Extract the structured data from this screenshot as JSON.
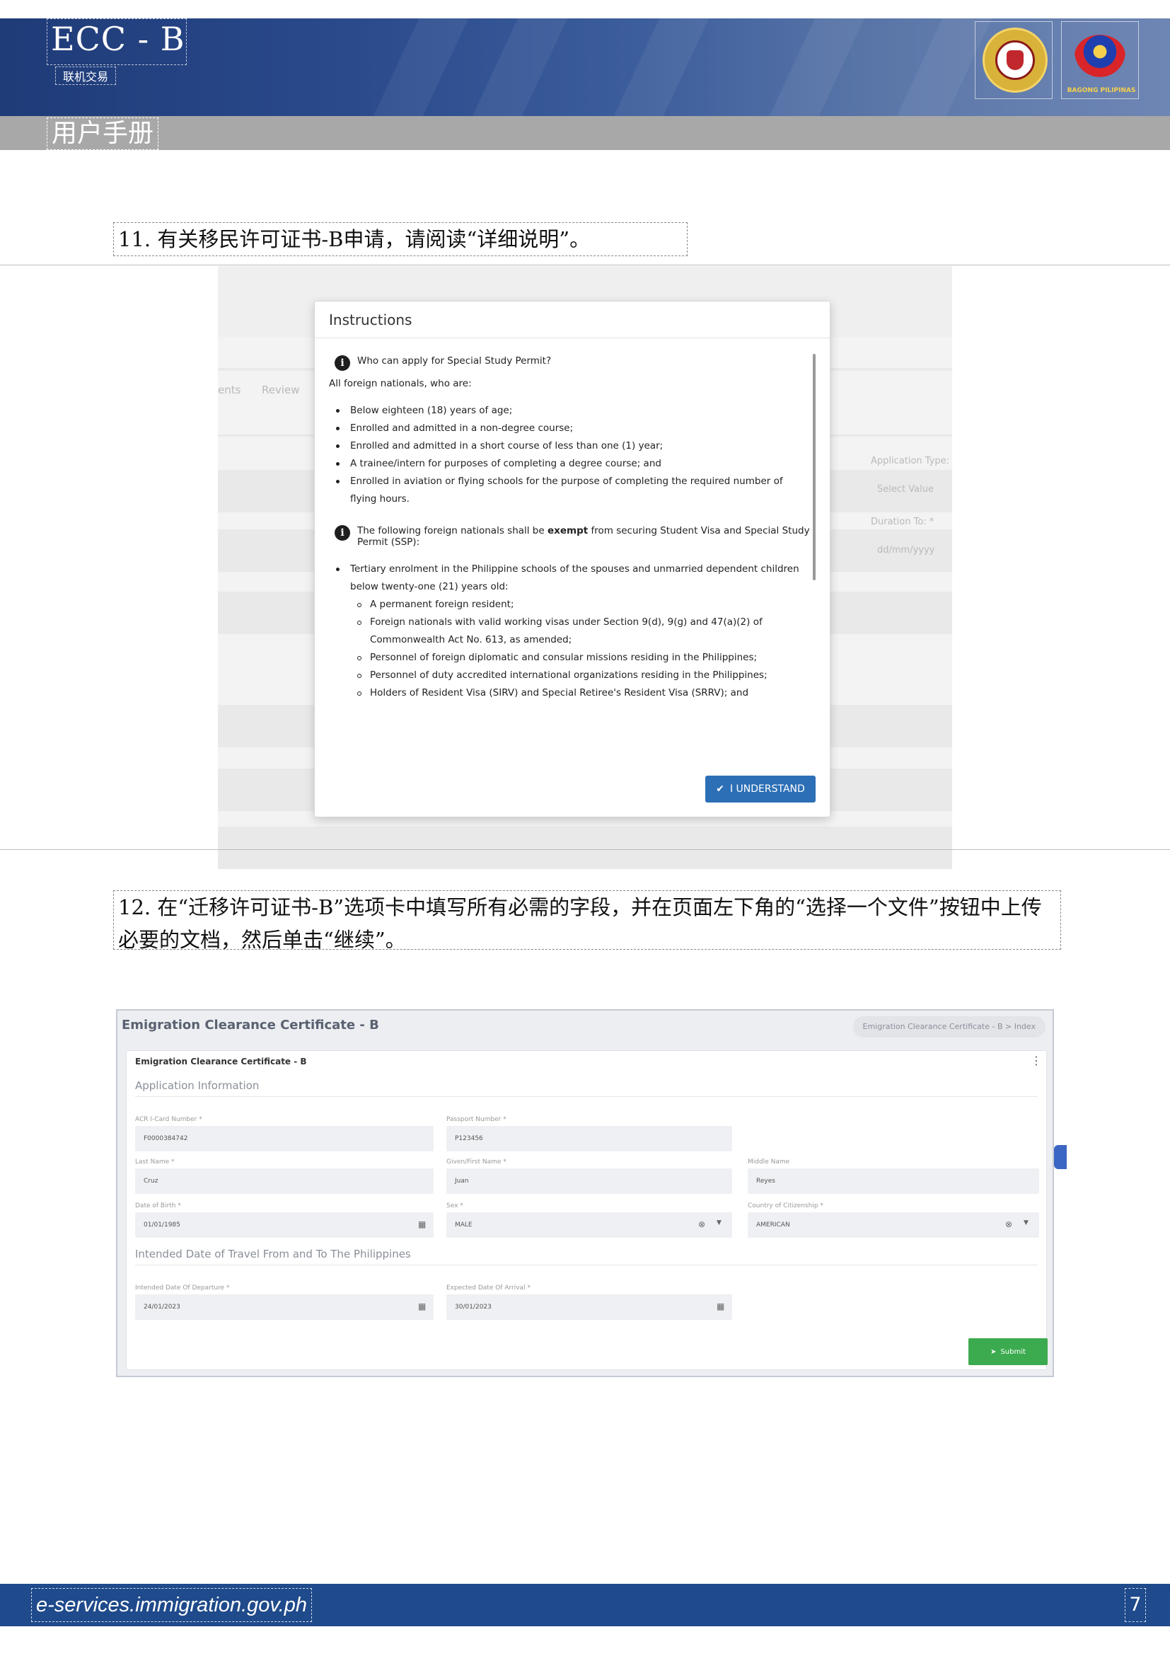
{
  "header": {
    "brand_title": "ECC - B",
    "brand_subtitle": "联机交易",
    "manual_title": "用户手册",
    "logo_seal_text": "BUREAU OF IMMIGRATION",
    "logo_bp_text": "BAGONG PILIPINAS"
  },
  "steps": {
    "step11": "11. 有关移民许可证书-B申请，请阅读“详细说明”。",
    "step12": "12. 在“迁移许可证书-B”选项卡中填写所有必需的字段，并在页面左下角的“选择一个文件”按钮中上传必要的文档，然后单击“继续”。"
  },
  "instructions_modal": {
    "title": "Instructions",
    "q1": "Who can apply for Special Study Permit?",
    "intro": "All foreign nationals, who are:",
    "items": [
      "Below eighteen (18) years of age;",
      "Enrolled and admitted in a non-degree course;",
      "Enrolled and admitted in a short course of less than one (1) year;",
      "A trainee/intern for purposes of completing a degree course; and",
      "Enrolled in aviation or flying schools for the purpose of completing the required number of flying hours."
    ],
    "exempt_note_pre": "The following foreign nationals shall be ",
    "exempt_note_bold": "exempt",
    "exempt_note_post": " from securing Student Visa and Special Study Permit (SSP):",
    "exempt_item": "Tertiary enrolment in the Philippine schools of the spouses and unmarried dependent children below twenty-one (21) years old:",
    "sub_items": [
      "A permanent foreign resident;",
      "Foreign nationals with valid working visas under Section 9(d), 9(g) and 47(a)(2) of Commonwealth Act No. 613, as amended;",
      "Personnel of foreign diplomatic and consular missions residing in the Philippines;",
      "Personnel of duty accredited international organizations residing in the Philippines;",
      "Holders of Resident Visa (SIRV) and Special Retiree's Resident Visa (SRRV); and"
    ],
    "button_label": "I UNDERSTAND",
    "bg_tabs": [
      "ents",
      "Review"
    ],
    "bg_labels": [
      "Application Type:",
      "Select Value",
      "Duration To: *",
      "dd/mm/yyyy"
    ]
  },
  "form": {
    "page_title": "Emigration Clearance Certificate - B",
    "breadcrumb": "Emigration Clearance Certificate - B  >  Index",
    "card_title": "Emigration Clearance Certificate - B",
    "section1": "Application Information",
    "section2": "Intended Date of Travel From and To The Philippines",
    "fields": {
      "acr_label": "ACR I-Card Number *",
      "acr_value": "F0000384742",
      "passport_label": "Passport Number *",
      "passport_value": "P123456",
      "last_label": "Last Name *",
      "last_value": "Cruz",
      "first_label": "Given/First Name *",
      "first_value": "Juan",
      "middle_label": "Middle Name",
      "middle_value": "Reyes",
      "dob_label": "Date of Birth *",
      "dob_value": "01/01/1985",
      "sex_label": "Sex *",
      "sex_value": "MALE",
      "citizenship_label": "Country of Citizenship *",
      "citizenship_value": "AMERICAN",
      "departure_label": "Intended Date Of Departure *",
      "departure_value": "24/01/2023",
      "arrival_label": "Expected Date Of Arrival *",
      "arrival_value": "30/01/2023"
    },
    "submit_label": "Submit"
  },
  "footer": {
    "url": "e-services.immigration.gov.ph",
    "page_number": "7"
  }
}
